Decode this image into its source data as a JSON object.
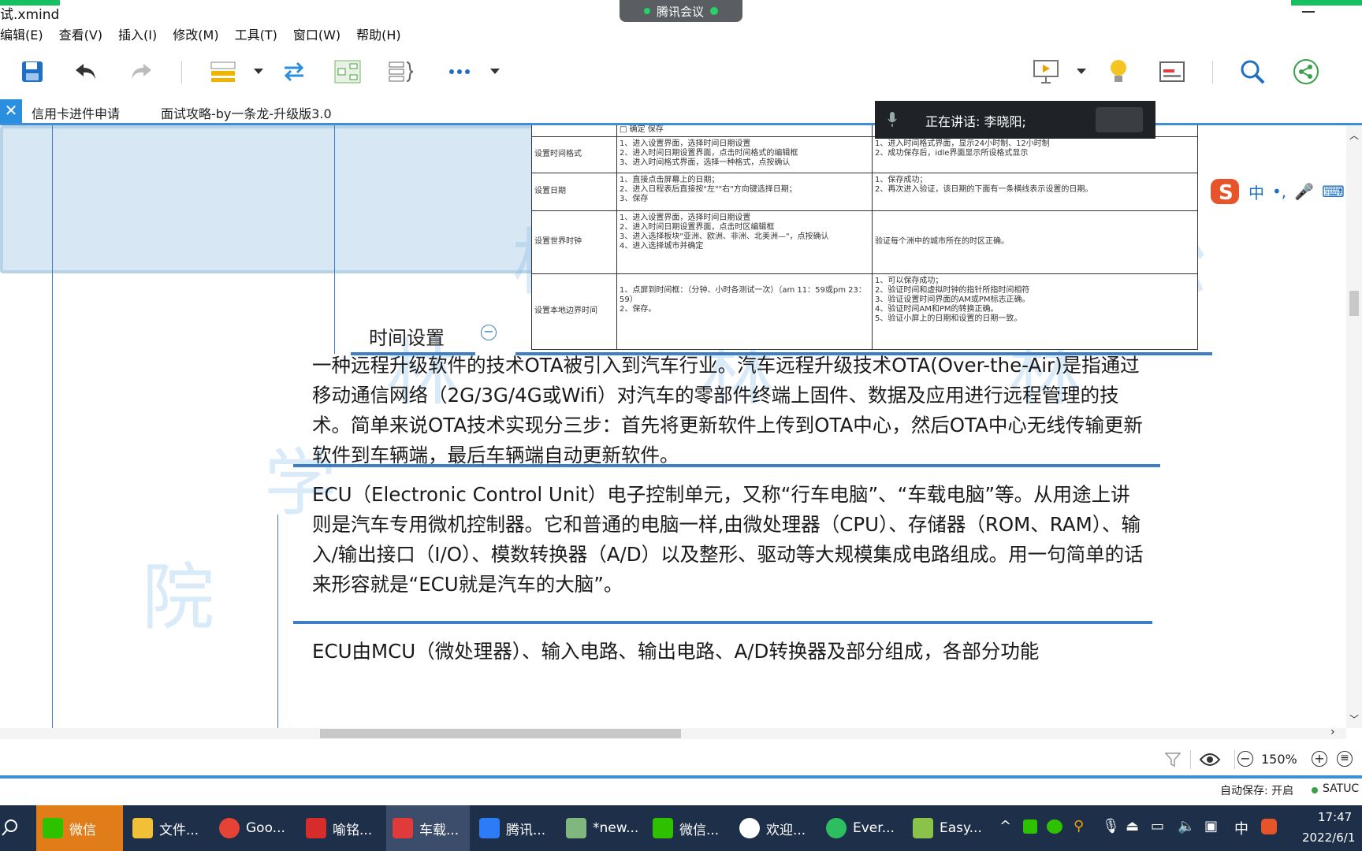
{
  "window": {
    "title": "试.xmind"
  },
  "meeting": {
    "label": "腾讯会议"
  },
  "menu": {
    "items": [
      "编辑(E)",
      "查看(V)",
      "插入(I)",
      "修改(M)",
      "工具(T)",
      "窗口(W)",
      "帮助(H)"
    ]
  },
  "tabs": [
    {
      "label": "信用卡进件申请"
    },
    {
      "label": "面试攻略-by一条龙-升级版3.0"
    }
  ],
  "speaking": {
    "label": "正在讲话: 李晓阳;"
  },
  "topic": {
    "label": "时间设置"
  },
  "table": {
    "rows": [
      {
        "name": "设置时间格式",
        "steps": "1、进入设置界面，选择时间日期设置\n2、进入时间日期设置界面，点击时间格式的编辑框\n3、进入时间格式界面，选择一种格式，点按确认",
        "expected": "1、进入时间格式界面，显示24小时制、12小时制\n2、成功保存后，idle界面显示所设格式显示"
      },
      {
        "name": "设置日期",
        "steps": "1、直接点击屏幕上的日期；\n2、进入日程表后直接按\"左\"\"右\"方向键选择日期；\n3、保存",
        "expected": "1、保存成功；\n2、再次进入验证，该日期的下面有一条横线表示设置的日期。"
      },
      {
        "name": "设置世界时钟",
        "steps": "1、进入设置界面，选择时间日期设置\n2、进入时间日期设置界面，点击时区编辑框\n3、进入选择板块\"亚洲、欧洲、非洲、北美洲—\"，点按确认\n4、进入选择城市并确定",
        "expected": "验证每个洲中的城市所在的时区正确。"
      },
      {
        "name": "设置本地边界时间",
        "steps": "1、点屏到时间框：（分钟、小时各测试一次）（am 11：59或pm 23：59）\n2、保存。",
        "expected": "1、可以保存成功；\n2、验证时间和虚拟时钟的指针所指时间相符\n3、验证设置时间界面的AM或PM标志正确。\n4、验证时间AM和PM的转换正确。\n5、验证小屏上的日期和设置的日期一致。"
      }
    ]
  },
  "notes": {
    "ota": "一种远程升级软件的技术OTA被引入到汽车行业。汽车远程升级技术OTA(Over-the-Air)是指通过移动通信网络（2G/3G/4G或Wifi）对汽车的零部件终端上固件、数据及应用进行远程管理的技术。简单来说OTA技术实现分三步：首先将更新软件上传到OTA中心，然后OTA中心无线传输更新软件到车辆端，最后车辆端自动更新软件。",
    "ecu": "ECU（Electronic Control Unit）电子控制单元，又称“行车电脑”、“车载电脑”等。从用途上讲则是汽车专用微机控制器。它和普通的电脑一样,由微处理器（CPU）、存储器（ROM、RAM）、输入/输出接口（I/O）、模数转换器（A/D）以及整形、驱动等大规模集成电路组成。用一句简单的话来形容就是“ECU就是汽车的大脑”。",
    "ecu2": "ECU由MCU（微处理器）、输入电路、输出电路、A/D转换器及部分组成，各部分功能"
  },
  "watermark": {
    "chars": [
      "松",
      "松",
      "松",
      "林",
      "林",
      "林",
      "学",
      "院"
    ]
  },
  "ime": {
    "labels": [
      "中",
      "•,"
    ]
  },
  "status": {
    "zoom": "150%",
    "autosave": "自动保存: 开启",
    "user": "SATUC"
  },
  "taskbar": {
    "items": [
      "微信",
      "文件...",
      "Goo...",
      "喻铭...",
      "车载...",
      "腾讯...",
      "*new...",
      "微信...",
      "欢迎...",
      "Ever...",
      "Easy..."
    ],
    "tray_ime": "中",
    "time": "17:47",
    "date": "2022/6/1"
  },
  "colors": {
    "accent": "#3c7fc4",
    "note_bg": "#d7e7f3",
    "taskbar": "#1e2f4a",
    "meeting_green": "#16c060"
  }
}
